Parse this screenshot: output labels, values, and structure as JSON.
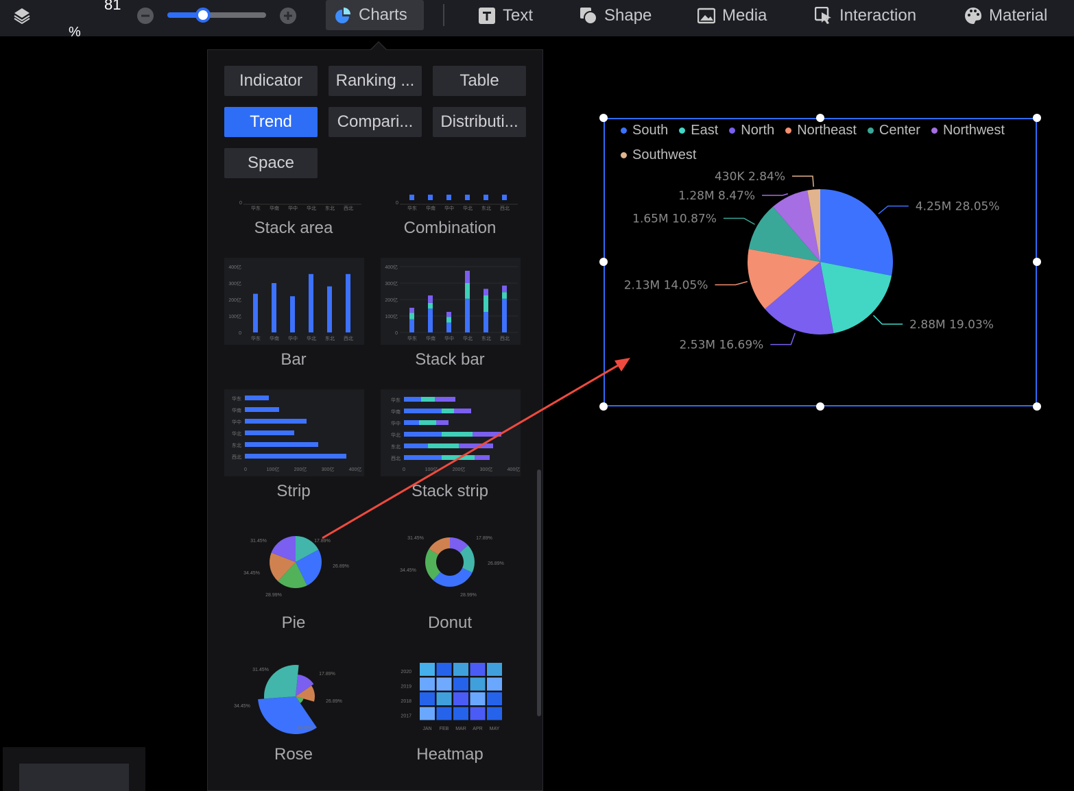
{
  "toolbar": {
    "zoom_value": "81",
    "zoom_unit": "%",
    "zoom_fraction": 0.36,
    "tools": [
      {
        "label": "Charts",
        "icon": "pie-chart-icon",
        "active": true
      },
      {
        "label": "Text",
        "icon": "text-icon"
      },
      {
        "label": "Shape",
        "icon": "shape-icon"
      },
      {
        "label": "Media",
        "icon": "media-icon"
      },
      {
        "label": "Interaction",
        "icon": "interaction-icon"
      },
      {
        "label": "Material",
        "icon": "palette-icon"
      }
    ]
  },
  "panel": {
    "categories": [
      "Indicator",
      "Ranking ...",
      "Table",
      "Trend",
      "Compari...",
      "Distributi...",
      "Space"
    ],
    "active_category": "Trend",
    "charts": [
      "Stack area",
      "Combination",
      "Bar",
      "Stack bar",
      "Strip",
      "Stack strip",
      "Pie",
      "Donut",
      "Rose",
      "Heatmap"
    ],
    "thumb_axis": {
      "x": [
        "华东",
        "华南",
        "华中",
        "华北",
        "东北",
        "西北"
      ],
      "y": [
        "0",
        "100亿",
        "200亿",
        "300亿",
        "400亿"
      ]
    },
    "pie_thumb_labels": [
      "31.45%",
      "17.89%",
      "26.89%",
      "34.45%",
      "28.99%"
    ],
    "heatmap_years": [
      "2020",
      "2019",
      "2018",
      "2017"
    ],
    "heatmap_months": [
      "JAN",
      "FEB",
      "MAR",
      "APR",
      "MAY"
    ]
  },
  "chart_data": {
    "type": "pie",
    "categories": [
      "South",
      "East",
      "North",
      "Northeast",
      "Center",
      "Northwest",
      "Southwest"
    ],
    "values": [
      4.25,
      2.88,
      2.53,
      2.13,
      1.65,
      1.28,
      0.43
    ],
    "unit": "M",
    "percents": [
      28.05,
      19.03,
      16.69,
      14.05,
      10.87,
      8.47,
      2.84
    ],
    "labels": [
      "4.25M 28.05%",
      "2.88M 19.03%",
      "2.53M 16.69%",
      "2.13M 14.05%",
      "1.65M 10.87%",
      "1.28M 8.47%",
      "430K 2.84%"
    ],
    "colors": [
      "#3d72fe",
      "#42d6c5",
      "#7a5ff0",
      "#f48f72",
      "#3aa899",
      "#a56ee3",
      "#e2b48e"
    ],
    "legend_position": "top-left"
  },
  "colors": {
    "accent": "#2e6df6",
    "arrow": "#f04a3e",
    "selection": "#2e6df6"
  }
}
